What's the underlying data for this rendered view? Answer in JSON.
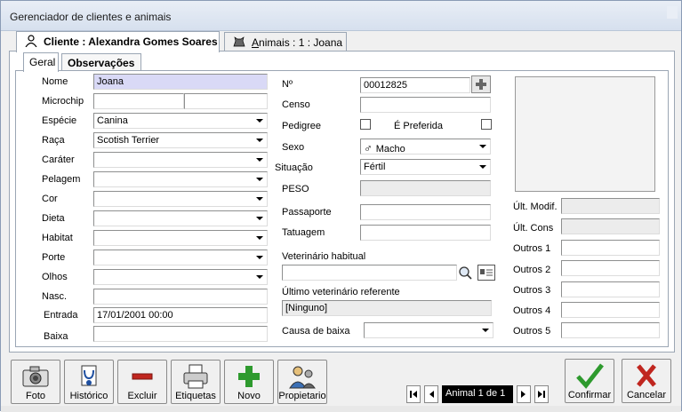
{
  "window": {
    "title": "Gerenciador de clientes e animais"
  },
  "tabs": {
    "cliente": {
      "label": "Cliente : Alexandra Gomes Soares"
    },
    "animais": {
      "label_underlined": "A",
      "label_rest": "nimais : 1 : Joana"
    }
  },
  "inner_tabs": {
    "geral": "Geral",
    "observacoes": "Observações"
  },
  "left": {
    "nome_label": "Nome",
    "nome_value": "Joana",
    "microchip_label": "Microchip",
    "especie_label": "Espécie",
    "especie_value": "Canina",
    "raca_label": "Raça",
    "raca_value": "Scotish Terrier",
    "carater_label": "Caráter",
    "pelagem_label": "Pelagem",
    "cor_label": "Cor",
    "dieta_label": "Dieta",
    "habitat_label": "Habitat",
    "porte_label": "Porte",
    "olhos_label": "Olhos",
    "nasc_label": "Nasc.",
    "entrada_label": "Entrada",
    "entrada_value": "17/01/2001  00:00",
    "baixa_label": "Baixa"
  },
  "middle": {
    "numero_label": "Nº",
    "numero_value": "00012825",
    "censo_label": "Censo",
    "pedigree_label": "Pedigree",
    "preferida_label": "É Preferida",
    "sexo_label": "Sexo",
    "sexo_value": "Macho",
    "situacao_label": "Situação",
    "situacao_value": "Fértil",
    "peso_label": "PESO",
    "passaporte_label": "Passaporte",
    "tatuagem_label": "Tatuagem",
    "vet_habitual_label": "Veterinário habitual",
    "ultimo_vet_label": "Último veterinário referente",
    "ultimo_vet_value": "[Ninguno]",
    "causa_baixa_label": "Causa de baixa"
  },
  "right": {
    "ult_modif_label": "Últ. Modif.",
    "ult_cons_label": "Últ. Cons",
    "outros1_label": "Outros 1",
    "outros2_label": "Outros 2",
    "outros3_label": "Outros 3",
    "outros4_label": "Outros 4",
    "outros5_label": "Outros 5"
  },
  "toolbar": {
    "foto": "Foto",
    "historico": "Histórico",
    "excluir": "Excluir",
    "etiquetas": "Etiquetas",
    "novo": "Novo",
    "propietario": "Propietario",
    "confirmar": "Confirmar",
    "cancelar": "Cancelar"
  },
  "navigator": {
    "record": "Animal 1 de 1"
  },
  "colors": {
    "accent_green": "#2e9a2e",
    "cancel_red": "#c0261f",
    "nome_highlight": "#d9d9f6"
  }
}
